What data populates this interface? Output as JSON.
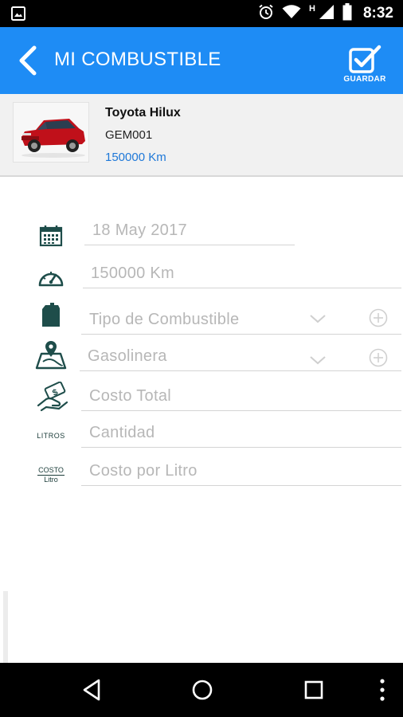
{
  "status_bar": {
    "time": "8:32",
    "network_letter": "H",
    "icons": [
      "image-icon",
      "alarm-icon",
      "wifi-icon",
      "signal-icon",
      "battery-icon"
    ]
  },
  "app_bar": {
    "title": "MI COMBUSTIBLE",
    "save_label": "GUARDAR",
    "background_color": "#1e8cf5"
  },
  "vehicle": {
    "name": "Toyota Hilux",
    "plate": "GEM001",
    "mileage": "150000 Km",
    "mileage_color": "#1e78d8"
  },
  "form": {
    "date": {
      "value": "18 May 2017",
      "icon": "calendar-icon"
    },
    "odometer": {
      "value": "150000 Km",
      "icon": "speedometer-icon"
    },
    "fuel_type": {
      "placeholder": "Tipo de Combustible",
      "icon": "fuel-can-icon"
    },
    "gas_station": {
      "placeholder": "Gasolinera",
      "icon": "map-pin-icon"
    },
    "total_cost": {
      "placeholder": "Costo Total",
      "icon": "money-hand-icon"
    },
    "quantity": {
      "placeholder": "Cantidad",
      "icon_label": "LITROS"
    },
    "cost_per_liter": {
      "placeholder": "Costo por Litro",
      "icon_label_top": "COSTO",
      "icon_label_bottom": "Litro"
    }
  },
  "nav_bar": {
    "buttons": [
      "back-icon",
      "home-icon",
      "recents-icon",
      "more-icon"
    ]
  }
}
